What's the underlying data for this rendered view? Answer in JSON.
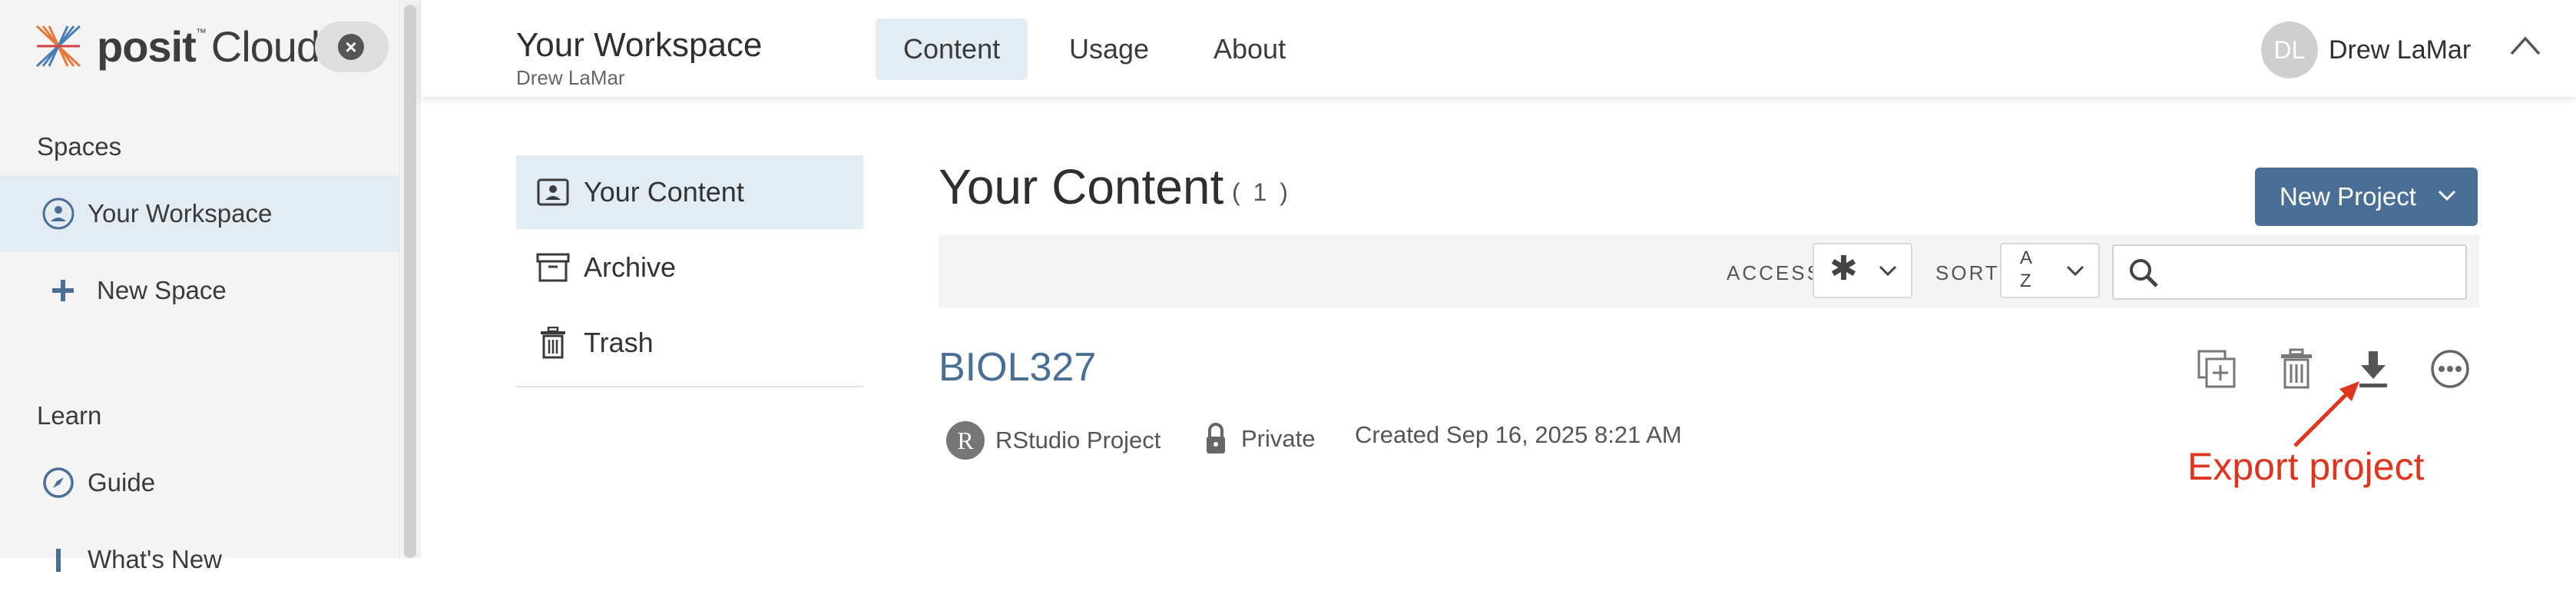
{
  "sidebar": {
    "logo_text": "posit",
    "logo_tm": "™",
    "logo_suffix": "Cloud",
    "spaces_heading": "Spaces",
    "items": [
      {
        "label": "Your Workspace",
        "icon": "user-circle-icon"
      },
      {
        "label": "New Space",
        "icon": "plus-icon"
      }
    ],
    "learn_heading": "Learn",
    "learn_items": [
      {
        "label": "Guide",
        "icon": "compass-icon"
      },
      {
        "label": "What's New",
        "icon": "info-icon"
      }
    ]
  },
  "header": {
    "title": "Your Workspace",
    "subtitle": "Drew LaMar",
    "tabs": [
      {
        "label": "Content",
        "active": true
      },
      {
        "label": "Usage"
      },
      {
        "label": "About"
      }
    ],
    "user": {
      "initials": "DL",
      "name": "Drew LaMar"
    }
  },
  "content_nav": [
    {
      "label": "Your Content",
      "icon": "person-card-icon",
      "active": true
    },
    {
      "label": "Archive",
      "icon": "archive-icon"
    },
    {
      "label": "Trash",
      "icon": "trash-icon"
    }
  ],
  "main": {
    "title": "Your Content",
    "count": "( 1 )",
    "new_project_label": "New Project",
    "filters": {
      "access_label": "ACCESS",
      "access_value": "✱",
      "sort_label": "SORT",
      "sort_value_top": "A",
      "sort_value_bottom": "Z",
      "search_placeholder": ""
    },
    "project": {
      "title": "BIOL327",
      "type_icon_letter": "R",
      "type": "RStudio Project",
      "access": "Private",
      "created": "Created Sep 16, 2025 8:21 AM"
    },
    "actions": [
      "copy-icon",
      "trash-icon",
      "download-icon",
      "more-icon"
    ]
  },
  "annotation": {
    "text": "Export project",
    "color": "#e0341e"
  },
  "colors": {
    "accent": "#4a6f96",
    "active_bg": "#e3ebf3",
    "sidebar_bg": "#f4f4f4"
  }
}
